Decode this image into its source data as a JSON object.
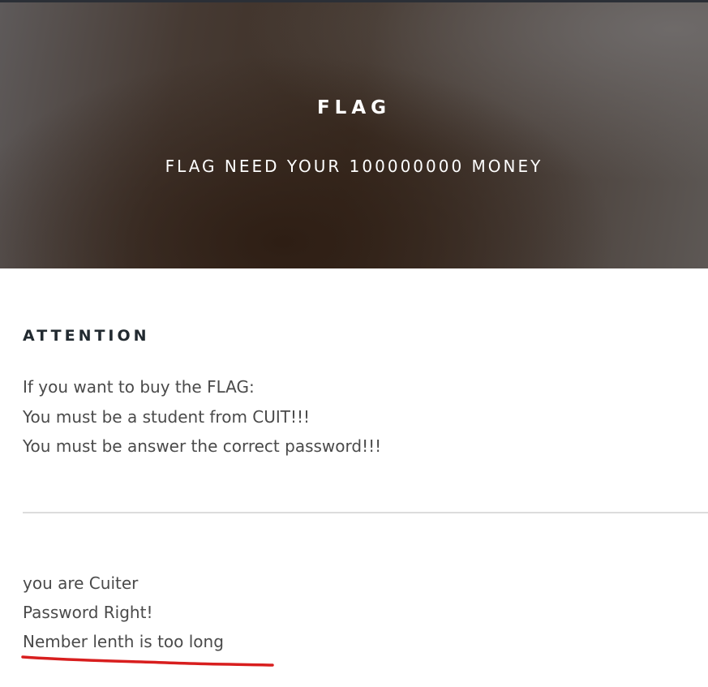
{
  "hero": {
    "title": "FLAG",
    "subtitle": "FLAG NEED YOUR 100000000 MONEY"
  },
  "attention": {
    "heading": "ATTENTION",
    "lines": [
      "If you want to buy the FLAG:",
      "You must be a student from CUIT!!!",
      "You must be answer the correct password!!!"
    ]
  },
  "result": {
    "lines": [
      "you are Cuiter",
      "Password Right!",
      "Nember lenth is too long"
    ]
  },
  "colors": {
    "annotation_red": "#d81e1e",
    "heading_dark": "#222a30",
    "body_text": "#4a4a4a"
  }
}
